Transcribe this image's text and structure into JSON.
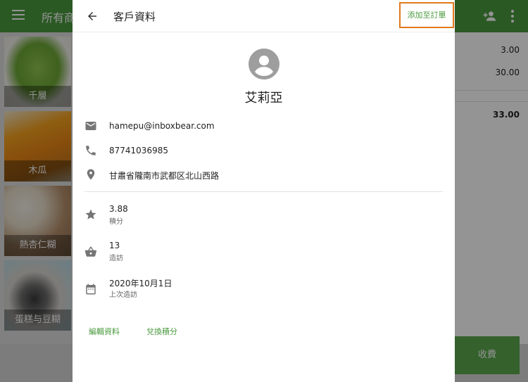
{
  "background": {
    "app_title": "所有商",
    "products": [
      {
        "name": "千層"
      },
      {
        "name": "木瓜"
      },
      {
        "name": "熱杏仁糊"
      },
      {
        "name": "蛋糕与豆糊"
      }
    ],
    "order_amounts": [
      "3.00",
      "30.00"
    ],
    "order_total": "33.00",
    "charge_label": "收費"
  },
  "dialog": {
    "title": "客戶資料",
    "add_to_order_label": "添加至訂單",
    "customer_name": "艾莉亞",
    "email": "hamepu@inboxbear.com",
    "phone": "87741036985",
    "address": "甘肅省隴南市武都区北山西路",
    "points": {
      "value": "3.88",
      "label": "積分"
    },
    "visits": {
      "value": "13",
      "label": "造訪"
    },
    "last_visit": {
      "value": "2020年10月1日",
      "label": "上次造訪"
    },
    "edit_label": "編輯資料",
    "redeem_label": "兌換積分"
  },
  "colors": {
    "brand_green": "#4a9a3e",
    "highlight_orange": "#e0791c",
    "icon_grey": "#757575"
  },
  "icons": {
    "back": "arrow-left-icon",
    "avatar": "account-circle-icon",
    "email": "email-icon",
    "phone": "phone-icon",
    "address": "location-pin-icon",
    "points": "star-icon",
    "visits": "basket-icon",
    "last_visit": "calendar-icon"
  }
}
